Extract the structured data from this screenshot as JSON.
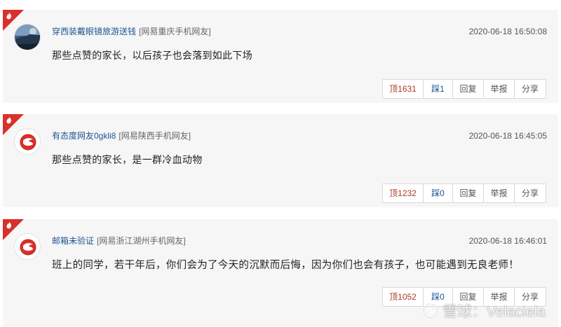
{
  "comments": [
    {
      "username": "穿西装戴眼镜旅游送钱",
      "location": "[网易重庆手机网友]",
      "time": "2020-06-18 16:50:08",
      "content": "那些点赞的家长，以后孩子也会落到如此下场",
      "up": "顶1631",
      "down": "踩1",
      "reply": "回复",
      "report": "举报",
      "share": "分享"
    },
    {
      "username": "有态度网友0gkli8",
      "location": "[网易陕西手机网友]",
      "time": "2020-06-18 16:45:05",
      "content": "那些点赞的家长，是一群冷血动物",
      "up": "顶1232",
      "down": "踩0",
      "reply": "回复",
      "report": "举报",
      "share": "分享"
    },
    {
      "username": "邮箱未验证",
      "location": "[网易浙江湖州手机网友]",
      "time": "2020-06-18 16:46:01",
      "content": "班上的同学，若干年后，你们会为了今天的沉默而后悔，因为你们也会有孩子，也可能遇到无良老师！",
      "up": "顶1052",
      "down": "踩0",
      "reply": "回复",
      "report": "举报",
      "share": "分享"
    }
  ],
  "watermark": {
    "text": "雪球：Velaciela"
  },
  "colors": {
    "username": "#1e5494",
    "up": "#a83b2a",
    "corner": "#d9302b",
    "card_bg": "#f6f6f6"
  },
  "icons": {
    "corner": "fire-icon",
    "default_avatar": "netease-logo-icon",
    "watermark": "xueqiu-logo-icon"
  }
}
